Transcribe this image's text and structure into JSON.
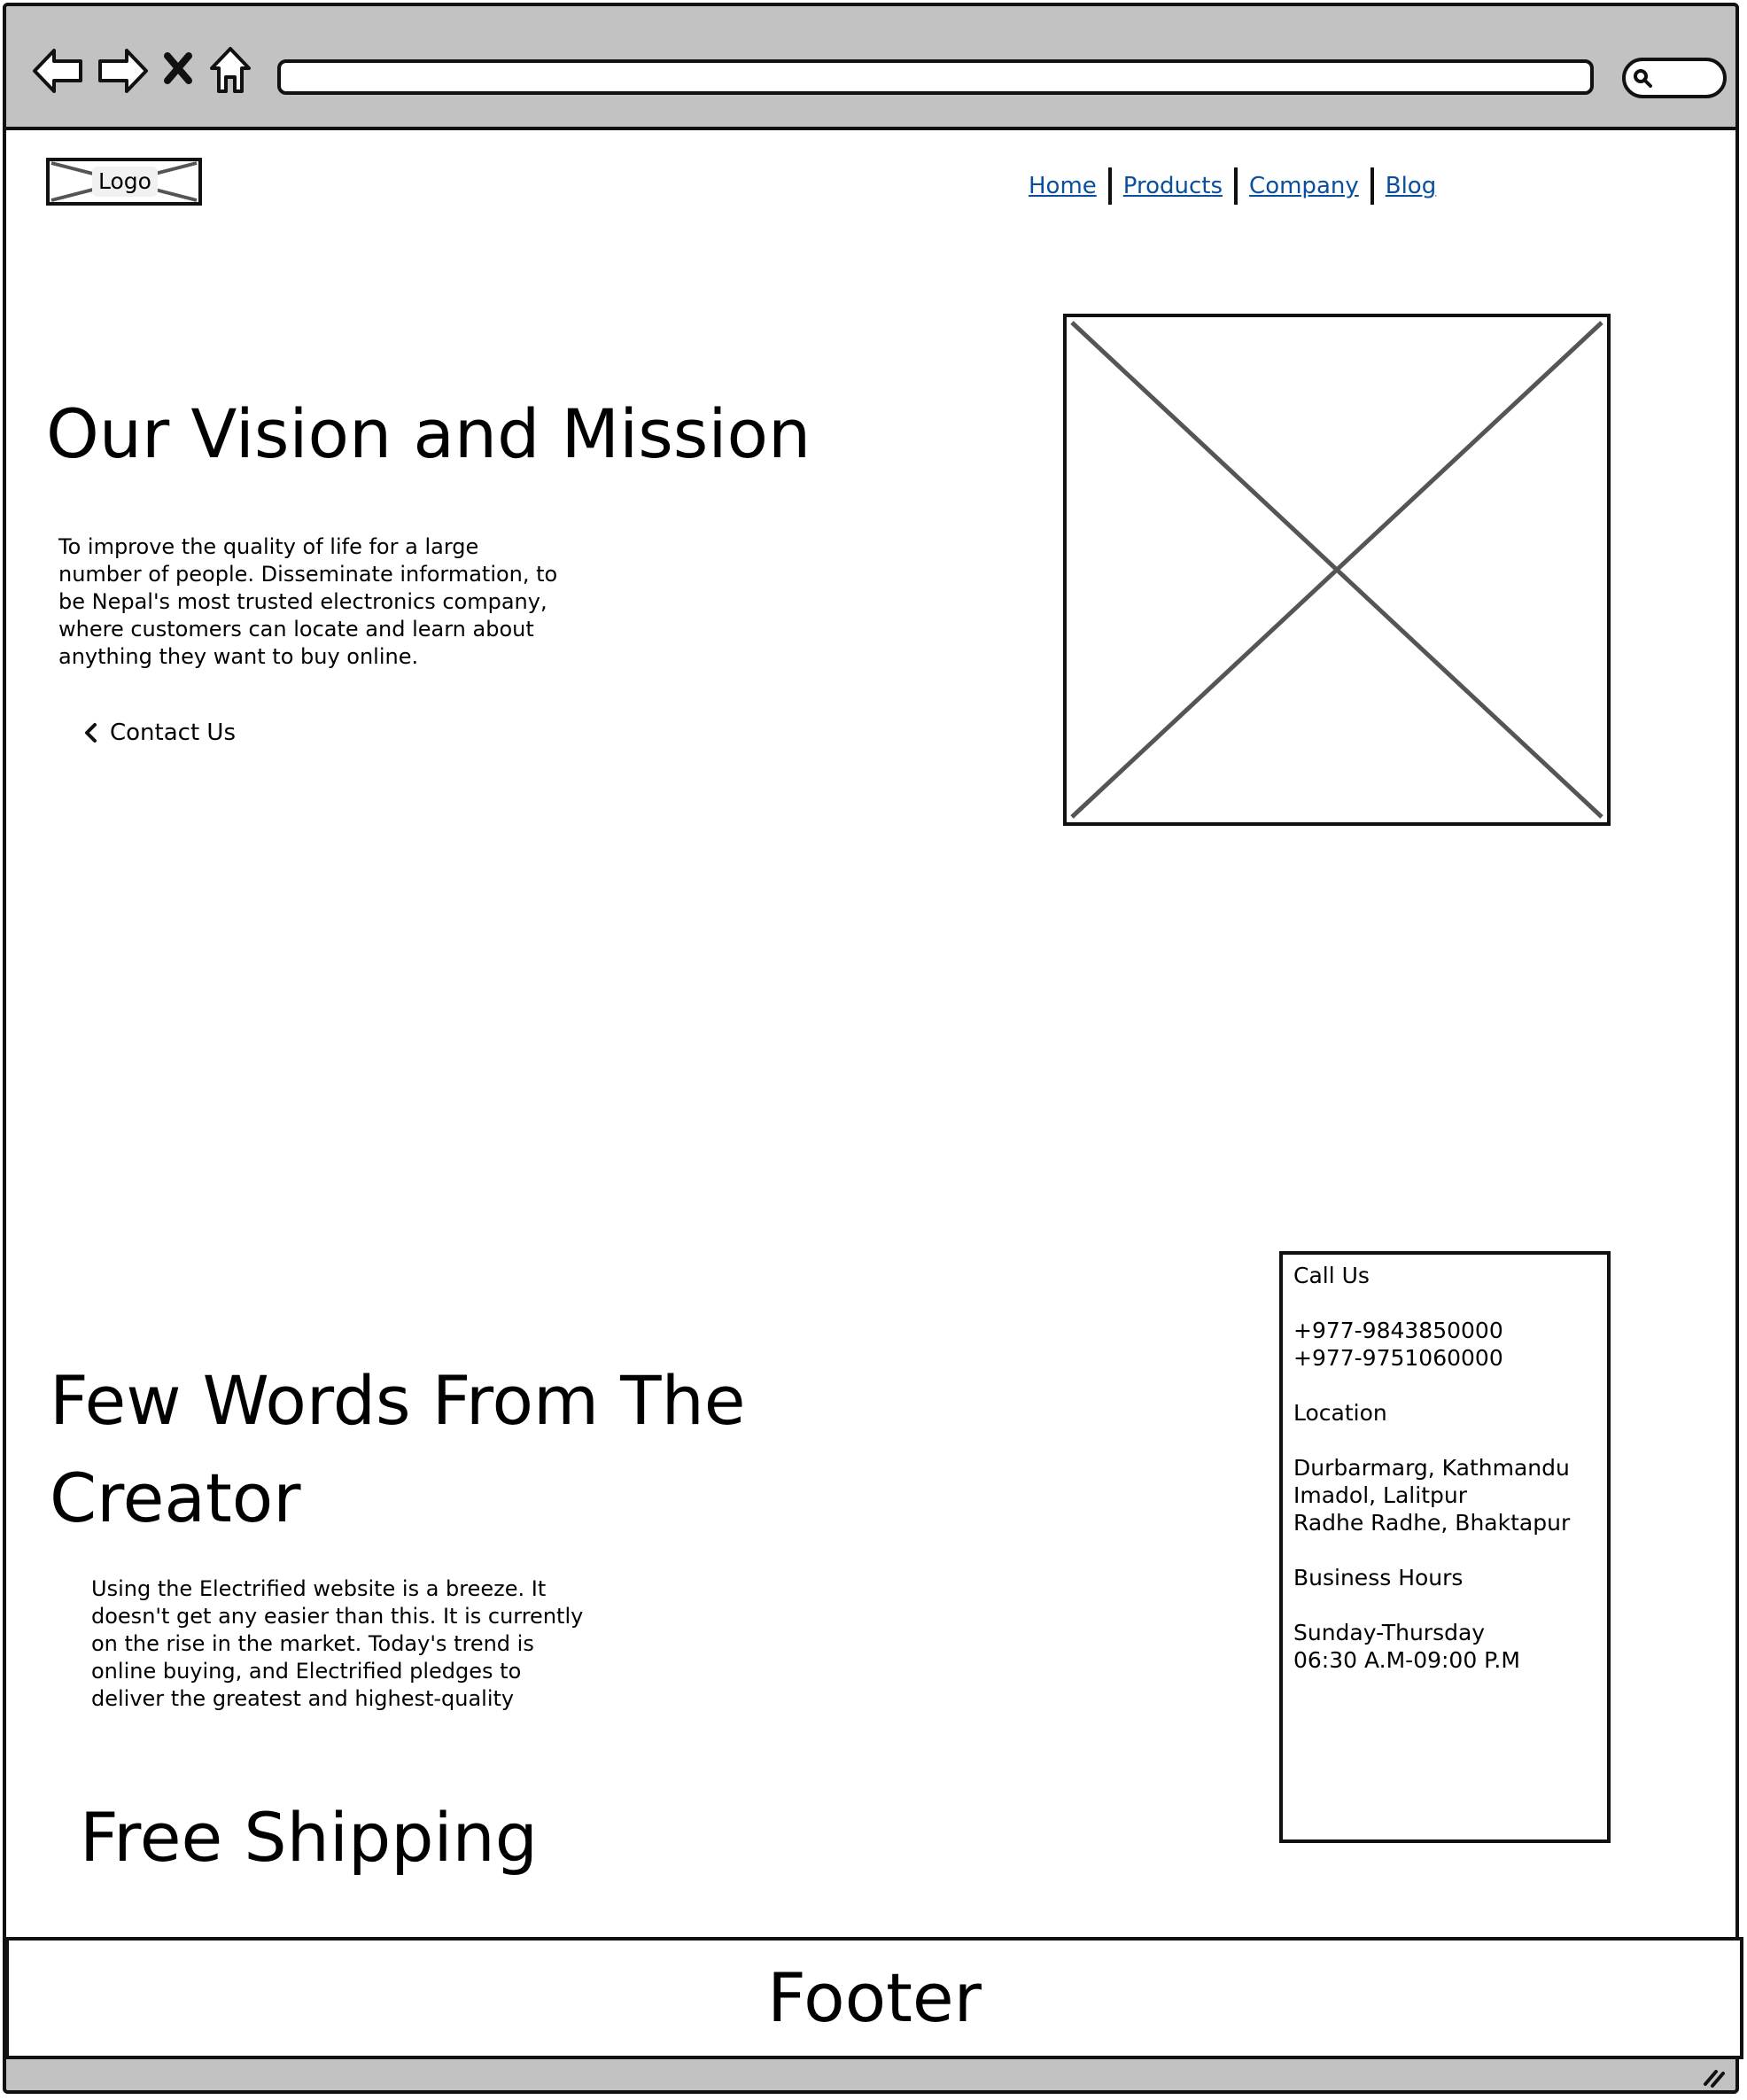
{
  "browser": {
    "icons": [
      "back-arrow-icon",
      "forward-arrow-icon",
      "close-icon",
      "home-icon",
      "search-icon",
      "resize-grip-icon"
    ],
    "address_value": ""
  },
  "header": {
    "logo_label": "Logo",
    "nav": [
      "Home",
      "Products",
      "Company",
      "Blog"
    ]
  },
  "vision": {
    "title": "Our Vision and Mission",
    "body": "To improve the quality of life for a large number of people. Disseminate information, to be Nepal's most trusted electronics company, where customers can locate and learn about anything they want to buy online.",
    "cta": "Contact Us"
  },
  "creator": {
    "title": "Few Words From The Creator",
    "body": "Using the Electrified website is a breeze. It doesn't get any easier than this. It is currently on the rise in the market. Today's trend is online buying, and Electrified pledges to deliver the greatest and highest-quality"
  },
  "shipping": {
    "title": "Free Shipping"
  },
  "info": {
    "call_heading": "Call Us",
    "phones": [
      "+977-9843850000",
      "+977-9751060000"
    ],
    "location_heading": "Location",
    "locations": [
      "Durbarmarg, Kathmandu",
      "Imadol, Lalitpur",
      "Radhe Radhe, Bhaktapur"
    ],
    "hours_heading": "Business Hours",
    "days": "Sunday-Thursday",
    "time": "06:30 A.M-09:00 P.M"
  },
  "footer": {
    "label": "Footer"
  },
  "colors": {
    "chrome": "#c2c2c2",
    "link": "#0a4f9e",
    "stroke": "#111111",
    "placeholder_x": "#555555"
  }
}
